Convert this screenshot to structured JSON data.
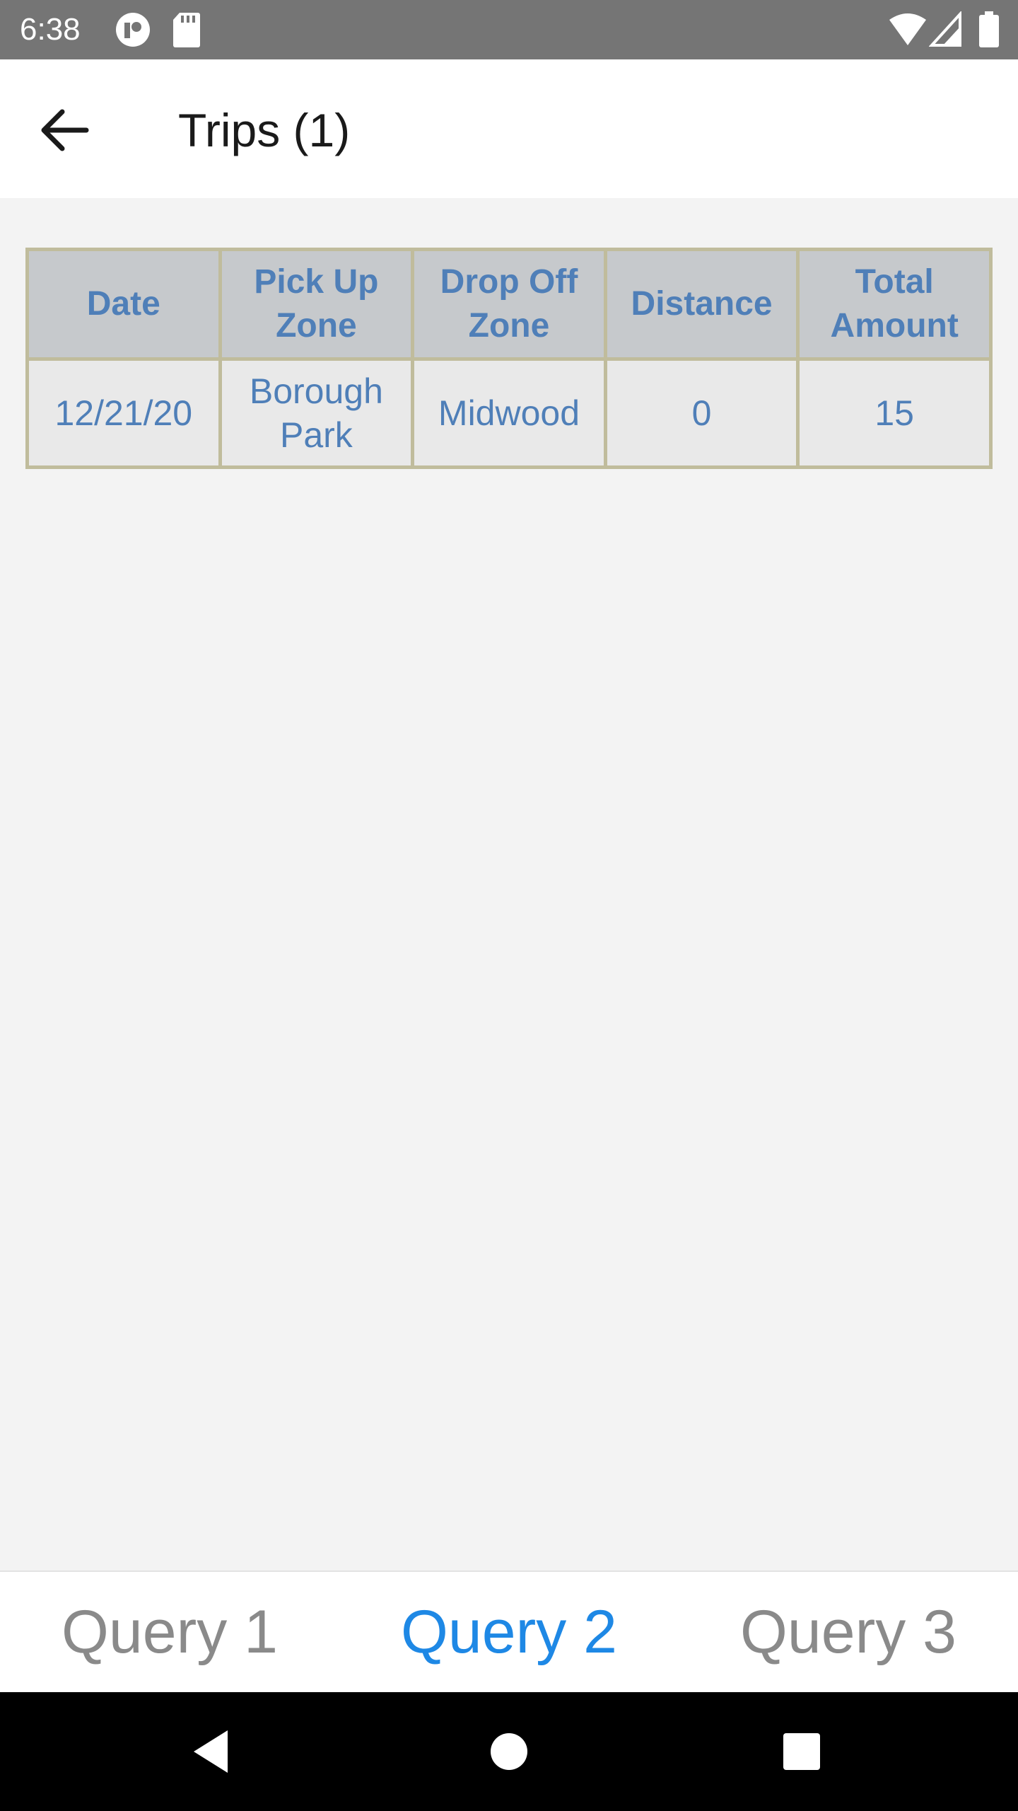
{
  "status_bar": {
    "time": "6:38",
    "left_icons": [
      "app-notification-icon",
      "sd-card-icon"
    ],
    "right_icons": [
      "wifi-icon",
      "signal-icon",
      "battery-icon"
    ]
  },
  "app_bar": {
    "back_icon": "arrow-left-icon",
    "title": "Trips (1)"
  },
  "table": {
    "headers": [
      "Date",
      "Pick Up Zone",
      "Drop Off Zone",
      "Distance",
      "Total Amount"
    ],
    "rows": [
      [
        "12/21/20",
        "Borough Park",
        "Midwood",
        "0",
        "15"
      ]
    ]
  },
  "bottom_tabs": [
    {
      "label": "Query 1",
      "active": false
    },
    {
      "label": "Query 2",
      "active": true
    },
    {
      "label": "Query 3",
      "active": false
    }
  ],
  "nav_bar": {
    "icons": [
      "back-triangle-icon",
      "home-circle-icon",
      "recents-square-icon"
    ]
  },
  "colors": {
    "status_bar": "#757575",
    "active_tab": "#1e88e5",
    "inactive_tab": "#8a8a8a",
    "table_text": "#4f7fb8",
    "table_border": "#c0bc9c",
    "header_bg": "#c6c9cc",
    "cell_bg": "#e9e9e9"
  }
}
